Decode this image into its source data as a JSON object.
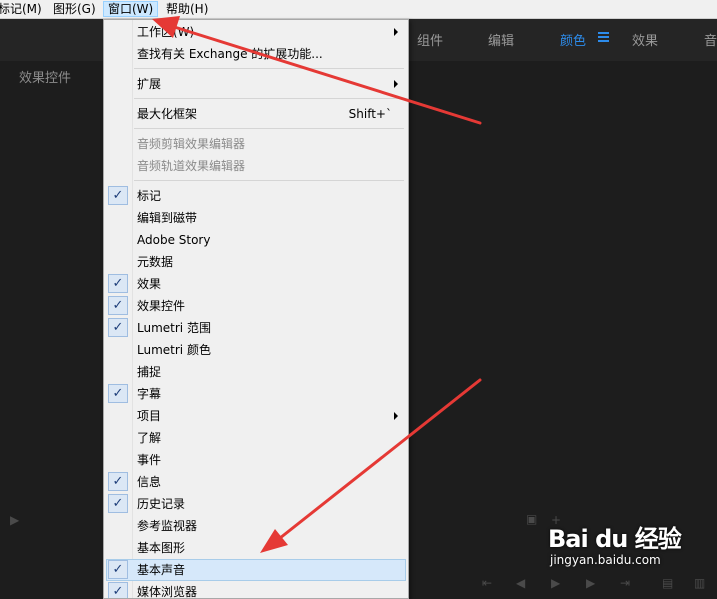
{
  "menubar": {
    "items": [
      {
        "label": "标记(M)",
        "active": false
      },
      {
        "label": "图形(G)",
        "active": false
      },
      {
        "label": "窗口(W)",
        "active": true
      },
      {
        "label": "帮助(H)",
        "active": false
      }
    ]
  },
  "workspace_tabs": [
    {
      "label": "组件",
      "active": false
    },
    {
      "label": "编辑",
      "active": false
    },
    {
      "label": "颜色",
      "active": true
    },
    {
      "label": "效果",
      "active": false
    },
    {
      "label": "音",
      "active": false
    }
  ],
  "panel": {
    "title": "效果控件"
  },
  "window_menu": {
    "items": [
      {
        "label": "工作区(W)",
        "submenu": true
      },
      {
        "label": "查找有关 Exchange 的扩展功能..."
      },
      {
        "label": "扩展",
        "submenu": true
      },
      {
        "label": "最大化框架",
        "shortcut": "Shift+`"
      },
      {
        "label": "音频剪辑效果编辑器",
        "disabled": true
      },
      {
        "label": "音频轨道效果编辑器",
        "disabled": true
      },
      {
        "label": "标记",
        "checked": true
      },
      {
        "label": "编辑到磁带"
      },
      {
        "label": "Adobe Story"
      },
      {
        "label": "元数据"
      },
      {
        "label": "效果",
        "checked": true
      },
      {
        "label": "效果控件",
        "checked": true
      },
      {
        "label": "Lumetri 范围",
        "checked": true
      },
      {
        "label": "Lumetri 颜色"
      },
      {
        "label": "捕捉"
      },
      {
        "label": "字幕",
        "checked": true
      },
      {
        "label": "项目",
        "submenu": true
      },
      {
        "label": "了解"
      },
      {
        "label": "事件"
      },
      {
        "label": "信息",
        "checked": true
      },
      {
        "label": "历史记录",
        "checked": true
      },
      {
        "label": "参考监视器"
      },
      {
        "label": "基本图形"
      },
      {
        "label": "基本声音",
        "checked": true,
        "highlighted": true
      },
      {
        "label": "媒体浏览器",
        "checked": true
      }
    ],
    "check_glyph": "✓"
  },
  "watermark": {
    "brand": "Bai du 经验",
    "url": "jingyan.baidu.com"
  },
  "colors": {
    "annotation_arrow": "#e53935",
    "accent": "#2d8ceb",
    "menu_highlight": "#d6e8fa"
  }
}
